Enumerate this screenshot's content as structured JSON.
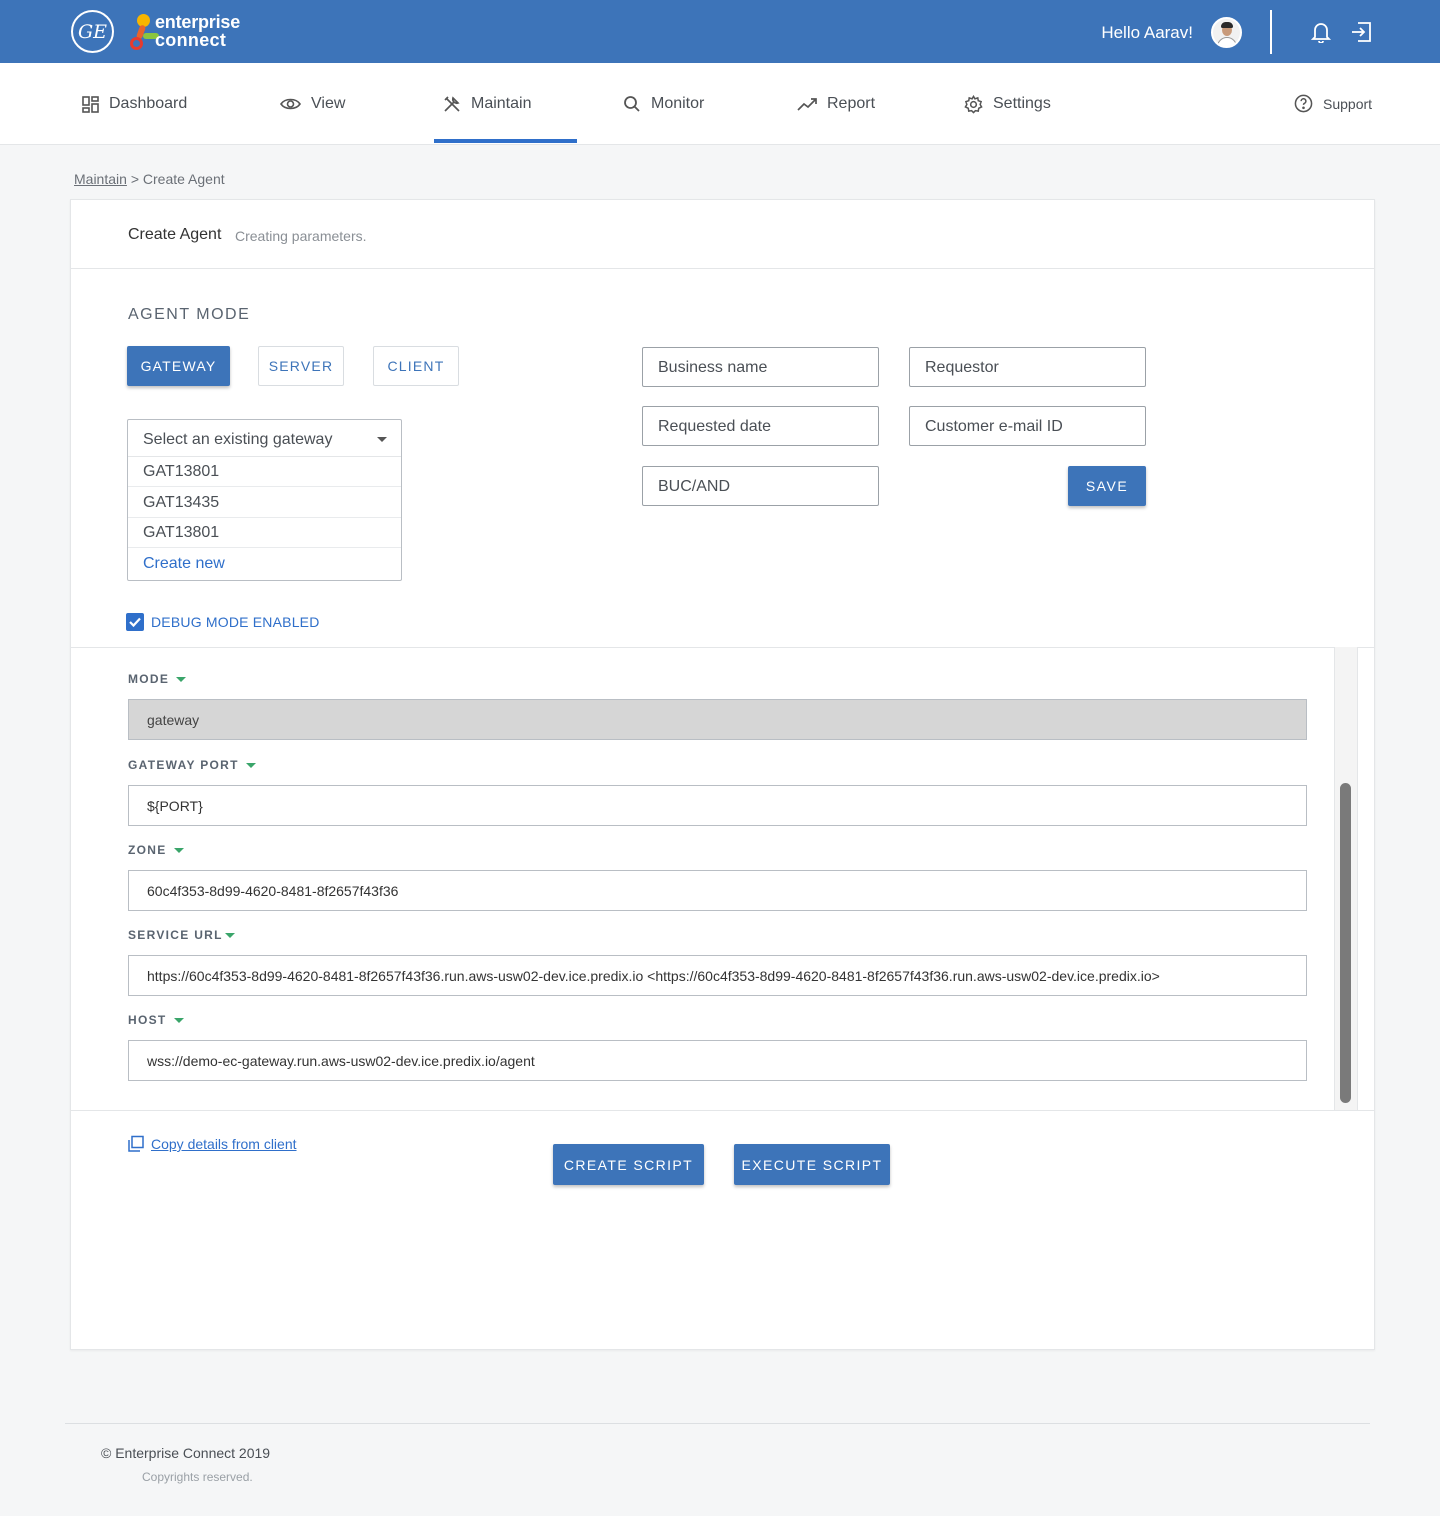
{
  "header": {
    "logo_text_line1": "enterprise",
    "logo_text_line2": "connect",
    "ge_logo_text": "GE",
    "greeting": "Hello Aarav!"
  },
  "nav": {
    "items": [
      {
        "label": "Dashboard",
        "icon": "dashboard-icon"
      },
      {
        "label": "View",
        "icon": "eye-icon"
      },
      {
        "label": "Maintain",
        "icon": "tools-icon",
        "active": true
      },
      {
        "label": "Monitor",
        "icon": "search-icon"
      },
      {
        "label": "Report",
        "icon": "trend-icon"
      },
      {
        "label": "Settings",
        "icon": "gear-icon"
      }
    ],
    "support_label": "Support"
  },
  "breadcrumb": {
    "parent": "Maintain",
    "separator": ">",
    "current": "Create Agent"
  },
  "card": {
    "title": "Create Agent",
    "subtitle": "Creating parameters."
  },
  "agent_mode": {
    "heading": "AGENT MODE",
    "buttons": [
      "GATEWAY",
      "SERVER",
      "CLIENT"
    ],
    "selected": "GATEWAY"
  },
  "gateway_select": {
    "placeholder": "Select an existing gateway",
    "options": [
      "GAT13801",
      "GAT13435",
      "GAT13801"
    ],
    "create_new": "Create new"
  },
  "form": {
    "business_name": "Business name",
    "requestor": "Requestor",
    "requested_date": "Requested date",
    "customer_email": "Customer e-mail ID",
    "buc_and": "BUC/AND",
    "save_label": "SAVE"
  },
  "debug": {
    "label": "DEBUG MODE ENABLED",
    "checked": true
  },
  "params": [
    {
      "label": "MODE",
      "value": "gateway",
      "disabled": true
    },
    {
      "label": "GATEWAY PORT",
      "value": "${PORT}"
    },
    {
      "label": "ZONE",
      "value": "60c4f353-8d99-4620-8481-8f2657f43f36"
    },
    {
      "label": "SERVICE URL",
      "value": "https://60c4f353-8d99-4620-8481-8f2657f43f36.run.aws-usw02-dev.ice.predix.io <https://60c4f353-8d99-4620-8481-8f2657f43f36.run.aws-usw02-dev.ice.predix.io>"
    },
    {
      "label": "HOST",
      "value": "wss://demo-ec-gateway.run.aws-usw02-dev.ice.predix.io/agent"
    }
  ],
  "actions": {
    "copy_link": "Copy details from client",
    "create_script": "CREATE SCRIPT",
    "execute_script": "EXECUTE SCRIPT"
  },
  "footer": {
    "copyright": "© Enterprise Connect 2019",
    "rights": "Copyrights reserved."
  },
  "colors": {
    "primary": "#3d74b9",
    "accent": "#2f6fca",
    "label_triangle": "#3aa56a"
  }
}
